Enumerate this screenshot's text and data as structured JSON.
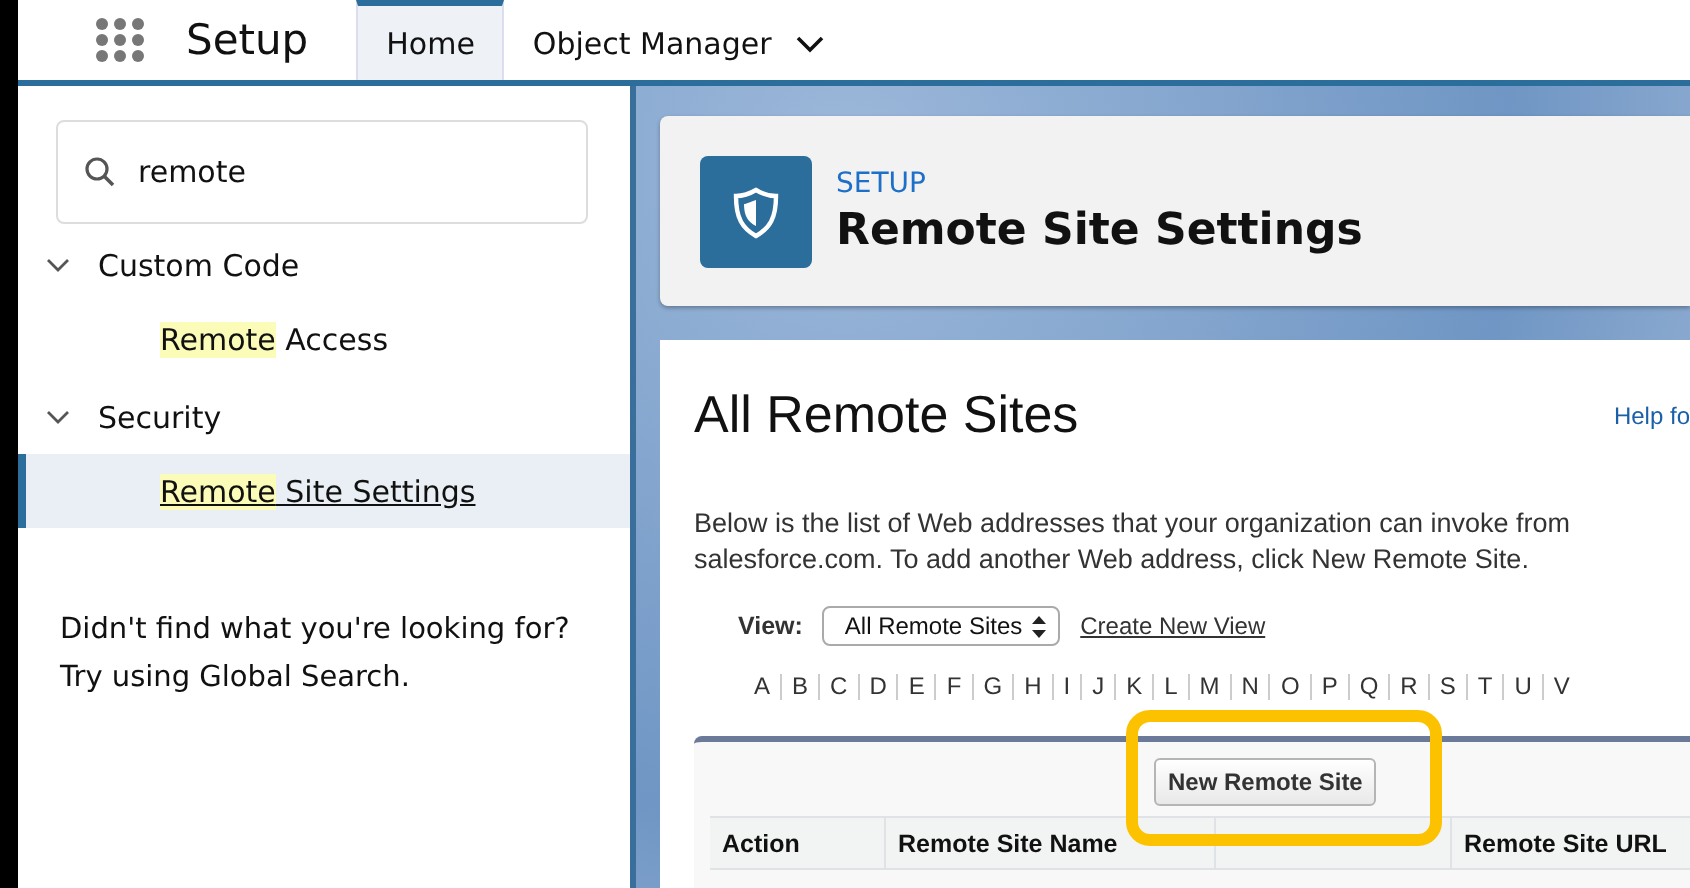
{
  "app": {
    "name": "Setup"
  },
  "tabs": [
    {
      "label": "Home",
      "selected": true
    },
    {
      "label": "Object Manager",
      "selected": false
    }
  ],
  "sidebar": {
    "search": {
      "value": "remote"
    },
    "groups": [
      {
        "label": "Custom Code",
        "expanded": true,
        "items": [
          {
            "match": "Remote",
            "rest": " Access",
            "selected": false
          }
        ]
      },
      {
        "label": "Security",
        "expanded": true,
        "items": [
          {
            "match": "Remote",
            "rest": " Site Settings",
            "selected": true
          }
        ]
      }
    ],
    "hint": [
      "Didn't find what you're looking for?",
      "Try using Global Search."
    ]
  },
  "header": {
    "eyebrow": "SETUP",
    "title": "Remote Site Settings"
  },
  "content": {
    "title": "All Remote Sites",
    "help_link": "Help fo",
    "description": "Below is the list of Web addresses that your organization can invoke from salesforce.com. To add another Web address, click New Remote Site.",
    "view_label": "View:",
    "view_value": "All Remote Sites",
    "create_view": "Create New View",
    "letters": [
      "A",
      "B",
      "C",
      "D",
      "E",
      "F",
      "G",
      "H",
      "I",
      "J",
      "K",
      "L",
      "M",
      "N",
      "O",
      "P",
      "Q",
      "R",
      "S",
      "T",
      "U",
      "V"
    ],
    "new_button": "New Remote Site",
    "columns": [
      "Action",
      "Remote Site Name",
      "",
      "Remote Site URL"
    ]
  }
}
